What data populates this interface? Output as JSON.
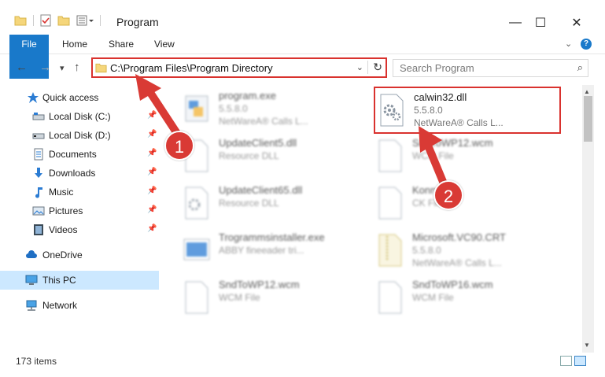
{
  "window": {
    "title": "Program",
    "min": "—",
    "max": "☐",
    "close": "✕"
  },
  "ribbon": {
    "tabs": [
      "File",
      "Home",
      "Share",
      "View"
    ],
    "help": "?"
  },
  "navigation": {
    "back": "←",
    "forward": "→",
    "recent": "▾",
    "up": "↑"
  },
  "address": {
    "path": "C:\\Program Files\\Program Directory",
    "dropdown": "⌄",
    "refresh": "↻"
  },
  "search": {
    "placeholder": "Search Program",
    "icon": "⌕"
  },
  "sidebar": {
    "items": [
      {
        "label": "Quick access",
        "icon": "star-icon"
      },
      {
        "label": "Local Disk (C:)",
        "icon": "drive-icon",
        "pinned": true
      },
      {
        "label": "Local Disk (D:)",
        "icon": "drive-icon",
        "pinned": true
      },
      {
        "label": "Documents",
        "icon": "documents-icon",
        "pinned": true
      },
      {
        "label": "Downloads",
        "icon": "download-icon",
        "pinned": true
      },
      {
        "label": "Music",
        "icon": "music-icon",
        "pinned": true
      },
      {
        "label": "Pictures",
        "icon": "pictures-icon",
        "pinned": true
      },
      {
        "label": "Videos",
        "icon": "videos-icon",
        "pinned": true
      },
      {
        "label": "OneDrive",
        "icon": "cloud-icon"
      },
      {
        "label": "This PC",
        "icon": "computer-icon",
        "selected": true
      },
      {
        "label": "Network",
        "icon": "network-icon"
      }
    ],
    "pin_glyph": "📌"
  },
  "files": [
    {
      "name": "program.exe",
      "line2": "5.5.8.0",
      "line3": "NetWareA® Calls L...",
      "icon": "exe-icon"
    },
    {
      "name": "calwin32.dll",
      "line2": "5.5.8.0",
      "line3": "NetWareA® Calls L...",
      "icon": "gears-file-icon"
    },
    {
      "name": "UpdateClient5.dll",
      "line2": "Resource DLL",
      "icon": "blank-file-icon"
    },
    {
      "name": "SndToWP12.wcm",
      "line2": "WCM File",
      "icon": "blank-file-icon"
    },
    {
      "name": "UpdateClient65.dll",
      "line2": "Resource DLL",
      "icon": "gears-file-icon"
    },
    {
      "name": "Konn...",
      "line2": "CK File",
      "icon": "blank-file-icon"
    },
    {
      "name": "Trogrammsinstaller.exe",
      "line2": "ABBY fineeader tri...",
      "icon": "installer-icon"
    },
    {
      "name": "Microsoft.VC90.CRT",
      "line2": "5.5.8.0",
      "line3": "NetWareA® Calls L...",
      "icon": "zip-file-icon"
    },
    {
      "name": "SndToWP12.wcm",
      "line2": "WCM File",
      "icon": "blank-file-icon"
    },
    {
      "name": "SndToWP16.wcm",
      "line2": "WCM File",
      "icon": "blank-file-icon"
    }
  ],
  "annotations": {
    "badge1": "1",
    "badge2": "2",
    "color": "#d93a35"
  },
  "status": {
    "count": "173 items"
  }
}
